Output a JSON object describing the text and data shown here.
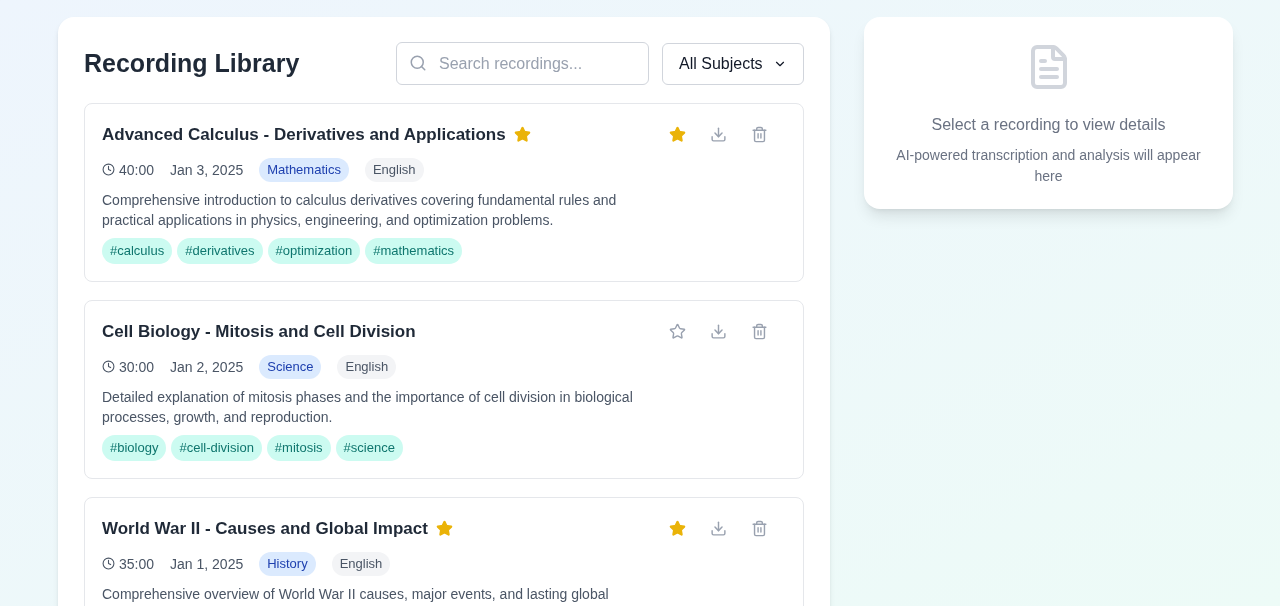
{
  "library": {
    "title": "Recording Library",
    "search": {
      "placeholder": "Search recordings..."
    },
    "filter": {
      "value": "All Subjects"
    }
  },
  "recordings": [
    {
      "title": "Advanced Calculus - Derivatives and Applications",
      "favorite": true,
      "duration": "40:00",
      "date": "Jan 3, 2025",
      "subject": "Mathematics",
      "language": "English",
      "description": "Comprehensive introduction to calculus derivatives covering fundamental rules and practical applications in physics, engineering, and optimization problems.",
      "tags": [
        "#calculus",
        "#derivatives",
        "#optimization",
        "#mathematics"
      ]
    },
    {
      "title": "Cell Biology - Mitosis and Cell Division",
      "favorite": false,
      "duration": "30:00",
      "date": "Jan 2, 2025",
      "subject": "Science",
      "language": "English",
      "description": "Detailed explanation of mitosis phases and the importance of cell division in biological processes, growth, and reproduction.",
      "tags": [
        "#biology",
        "#cell-division",
        "#mitosis",
        "#science"
      ]
    },
    {
      "title": "World War II - Causes and Global Impact",
      "favorite": true,
      "duration": "35:00",
      "date": "Jan 1, 2025",
      "subject": "History",
      "language": "English",
      "description": "Comprehensive overview of World War II causes, major events, and lasting global"
    }
  ],
  "details": {
    "title": "Select a recording to view details",
    "hint": "AI-powered transcription and analysis will appear here"
  }
}
